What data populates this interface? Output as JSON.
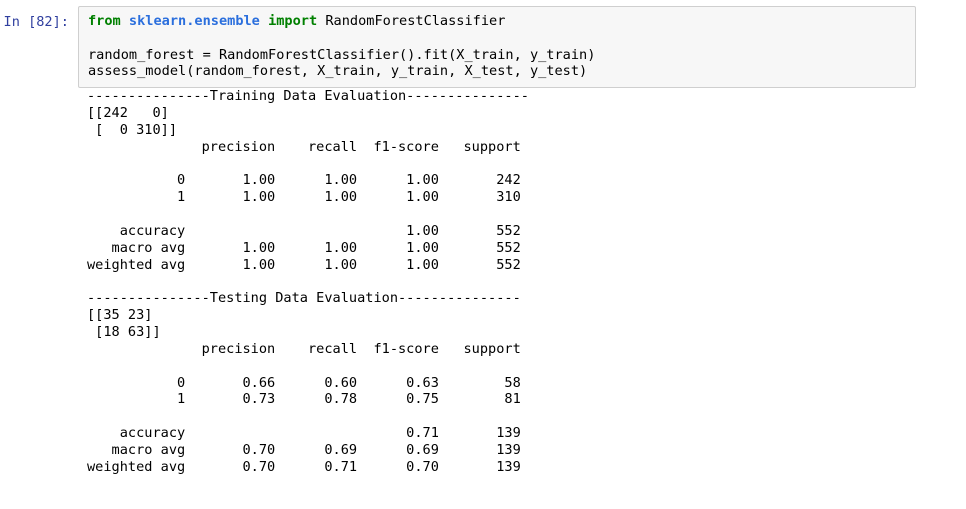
{
  "cell": {
    "prompt_label": "In [82]:",
    "code_lines": [
      [
        {
          "t": "from ",
          "c": "kw"
        },
        {
          "t": "sklearn.ensemble",
          "c": "module"
        },
        {
          "t": " ",
          "c": "plain"
        },
        {
          "t": "import",
          "c": "kw"
        },
        {
          "t": " RandomForestClassifier",
          "c": "plain"
        }
      ],
      [
        {
          "t": " ",
          "c": "blank"
        }
      ],
      [
        {
          "t": "random_forest = RandomForestClassifier().fit(X_train, y_train)",
          "c": "plain"
        }
      ],
      [
        {
          "t": "assess_model(random_forest, X_train, y_train, X_test, y_test)",
          "c": "plain"
        }
      ]
    ],
    "output_text": "---------------Training Data Evaluation---------------\n[[242   0]\n [  0 310]]\n              precision    recall  f1-score   support\n\n           0       1.00      1.00      1.00       242\n           1       1.00      1.00      1.00       310\n\n    accuracy                           1.00       552\n   macro avg       1.00      1.00      1.00       552\nweighted avg       1.00      1.00      1.00       552\n\n---------------Testing Data Evaluation---------------\n[[35 23]\n [18 63]]\n              precision    recall  f1-score   support\n\n           0       0.66      0.60      0.63        58\n           1       0.73      0.78      0.75        81\n\n    accuracy                           0.71       139\n   macro avg       0.70      0.69      0.69       139\nweighted avg       0.70      0.71      0.70       139"
  },
  "output_reports": {
    "training": {
      "banner": "---------------Training Data Evaluation---------------",
      "title": "Training Data Evaluation",
      "confusion_matrix": [
        [
          242,
          0
        ],
        [
          0,
          310
        ]
      ],
      "columns": [
        "precision",
        "recall",
        "f1-score",
        "support"
      ],
      "rows": [
        {
          "label": "0",
          "precision": "1.00",
          "recall": "1.00",
          "f1-score": "1.00",
          "support": "242"
        },
        {
          "label": "1",
          "precision": "1.00",
          "recall": "1.00",
          "f1-score": "1.00",
          "support": "310"
        },
        {
          "label": "accuracy",
          "precision": "",
          "recall": "",
          "f1-score": "1.00",
          "support": "552"
        },
        {
          "label": "macro avg",
          "precision": "1.00",
          "recall": "1.00",
          "f1-score": "1.00",
          "support": "552"
        },
        {
          "label": "weighted avg",
          "precision": "1.00",
          "recall": "1.00",
          "f1-score": "1.00",
          "support": "552"
        }
      ]
    },
    "testing": {
      "banner": "---------------Testing Data Evaluation---------------",
      "title": "Testing Data Evaluation",
      "confusion_matrix": [
        [
          35,
          23
        ],
        [
          18,
          63
        ]
      ],
      "columns": [
        "precision",
        "recall",
        "f1-score",
        "support"
      ],
      "rows": [
        {
          "label": "0",
          "precision": "0.66",
          "recall": "0.60",
          "f1-score": "0.63",
          "support": "58"
        },
        {
          "label": "1",
          "precision": "0.73",
          "recall": "0.78",
          "f1-score": "0.75",
          "support": "81"
        },
        {
          "label": "accuracy",
          "precision": "",
          "recall": "",
          "f1-score": "0.71",
          "support": "139"
        },
        {
          "label": "macro avg",
          "precision": "0.70",
          "recall": "0.69",
          "f1-score": "0.69",
          "support": "139"
        },
        {
          "label": "weighted avg",
          "precision": "0.70",
          "recall": "0.71",
          "f1-score": "0.70",
          "support": "139"
        }
      ]
    }
  },
  "colors": {
    "prompt": "#303f9f",
    "keyword": "#008000",
    "module": "#2b6fdd",
    "code_bg": "#f7f7f7",
    "code_border": "#cfcfcf",
    "text": "#000000"
  }
}
